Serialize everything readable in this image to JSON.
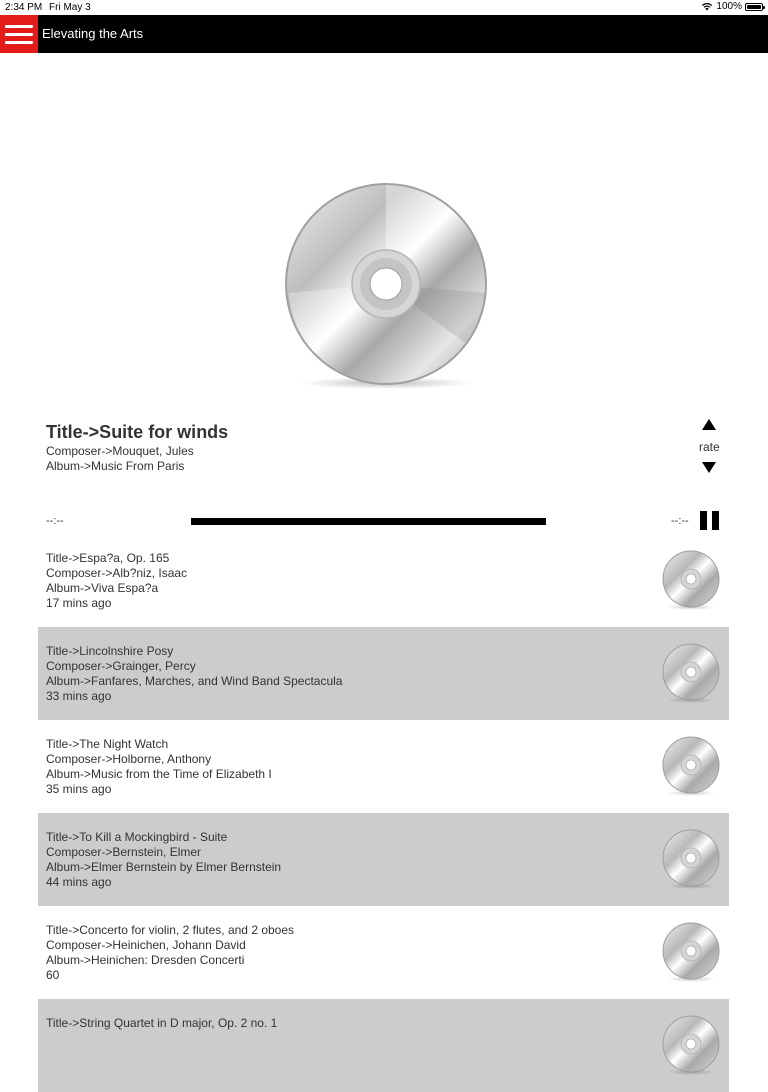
{
  "status_bar": {
    "time": "2:34 PM",
    "date": "Fri May 3",
    "battery": "100%"
  },
  "header": {
    "title": "Elevating the Arts",
    "menu_icon": "hamburger-menu-icon",
    "menu_color": "#e21b1b"
  },
  "now_playing": {
    "title": "Title->Suite for winds",
    "composer": "Composer->Mouquet, Jules",
    "album": "Album->Music From Paris",
    "rate_label": "rate",
    "elapsed": "--:--",
    "remaining": "--:--"
  },
  "history": [
    {
      "title": "Title->Espa?a, Op. 165",
      "composer": "Composer->Alb?niz, Isaac",
      "album": "Album->Viva Espa?a",
      "ago": "17 mins ago"
    },
    {
      "title": "Title->Lincolnshire Posy",
      "composer": "Composer->Grainger, Percy",
      "album": "Album->Fanfares, Marches, and Wind Band Spectacula",
      "ago": "33 mins ago"
    },
    {
      "title": "Title->The Night Watch",
      "composer": "Composer->Holborne, Anthony",
      "album": "Album->Music from the Time of Elizabeth I",
      "ago": "35 mins ago"
    },
    {
      "title": "Title->To Kill a Mockingbird - Suite",
      "composer": "Composer->Bernstein, Elmer",
      "album": "Album->Elmer Bernstein by Elmer Bernstein",
      "ago": "44 mins ago"
    },
    {
      "title": "Title->Concerto for violin, 2 flutes, and 2 oboes",
      "composer": "Composer->Heinichen, Johann David",
      "album": "Album->Heinichen: Dresden Concerti",
      "ago": "60"
    },
    {
      "title": "Title->String Quartet in D major, Op. 2 no. 1",
      "composer": "",
      "album": "",
      "ago": ""
    }
  ]
}
